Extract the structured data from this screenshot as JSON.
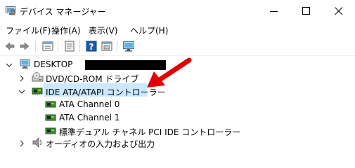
{
  "window": {
    "title": "デバイス マネージャー",
    "controls": {
      "minimize": "─",
      "maximize": "☐",
      "close": "✕"
    }
  },
  "menu": {
    "items": [
      {
        "label": "ファイル(F)"
      },
      {
        "label": "操作(A)"
      },
      {
        "label": "表示(V)"
      },
      {
        "label": "ヘルプ(H)"
      }
    ]
  },
  "toolbar": {
    "buttons": [
      {
        "icon": "back-arrow-icon"
      },
      {
        "icon": "forward-arrow-icon"
      },
      {
        "icon": "properties-icon"
      },
      {
        "icon": "update-driver-icon"
      },
      {
        "icon": "help-icon"
      },
      {
        "icon": "show-hidden-icon"
      },
      {
        "icon": "monitor-scan-icon"
      }
    ]
  },
  "tree": {
    "root": {
      "label": "DESKTOP"
    },
    "nodes": [
      {
        "label": "DVD/CD-ROM ドライブ",
        "expanded": false
      },
      {
        "label": "IDE ATA/ATAPI コントローラー",
        "expanded": true,
        "selected": true,
        "children": [
          {
            "label": "ATA Channel 0"
          },
          {
            "label": "ATA Channel 1"
          },
          {
            "label": "標準デュアル チャネル PCI IDE コントローラー"
          }
        ]
      },
      {
        "label": "オーディオの入力および出力",
        "expanded": false
      }
    ]
  },
  "colors": {
    "selection": "#cce8ff",
    "annotation_arrow": "#e00000",
    "redaction": "#000000"
  }
}
